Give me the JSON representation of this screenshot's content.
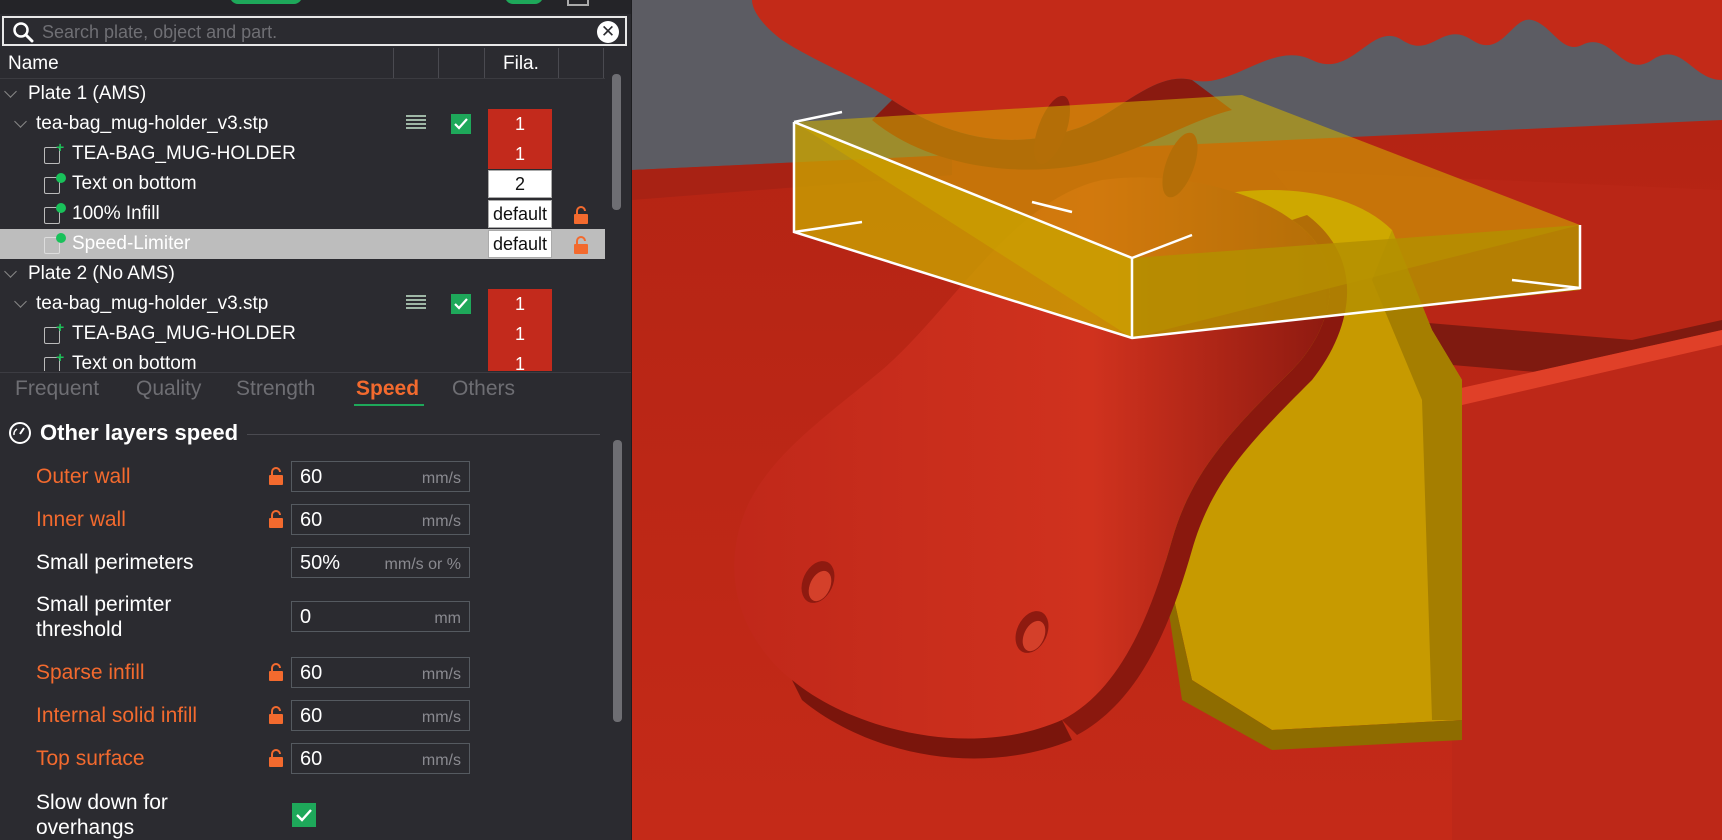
{
  "search": {
    "placeholder": "Search plate, object and part."
  },
  "objects_table": {
    "headers": {
      "name": "Name",
      "filament": "Fila."
    },
    "rows": [
      {
        "label": "Plate 1 (AMS)"
      },
      {
        "label": "tea-bag_mug-holder_v3.stp",
        "filament": "1"
      },
      {
        "label": "TEA-BAG_MUG-HOLDER",
        "filament": "1"
      },
      {
        "label": "Text on bottom",
        "filament": "2"
      },
      {
        "label": "100% Infill",
        "filament": "default"
      },
      {
        "label": "Speed-Limiter",
        "filament": "default",
        "selected": true
      },
      {
        "label": "Plate 2 (No AMS)"
      },
      {
        "label": "tea-bag_mug-holder_v3.stp",
        "filament": "1"
      },
      {
        "label": "TEA-BAG_MUG-HOLDER",
        "filament": "1"
      },
      {
        "label": "Text on bottom",
        "filament": "1"
      }
    ]
  },
  "settings_tabs": [
    "Frequent",
    "Quality",
    "Strength",
    "Speed",
    "Others"
  ],
  "active_tab": "Speed",
  "section": {
    "title": "Other layers speed"
  },
  "params": [
    {
      "label": "Outer wall",
      "value": "60",
      "unit": "mm/s"
    },
    {
      "label": "Inner wall",
      "value": "60",
      "unit": "mm/s"
    },
    {
      "label": "Small perimeters",
      "value": "50%",
      "unit": "mm/s or %"
    },
    {
      "label": "Small perimter threshold",
      "label_line1": "Small perimter",
      "label_line2": "threshold",
      "value": "0",
      "unit": "mm"
    },
    {
      "label": "Sparse infill",
      "value": "60",
      "unit": "mm/s"
    },
    {
      "label": "Internal solid infill",
      "value": "60",
      "unit": "mm/s"
    },
    {
      "label": "Top surface",
      "value": "60",
      "unit": "mm/s"
    },
    {
      "label": "Slow down for overhangs",
      "label_line1": "Slow down for",
      "label_line2": "overhangs",
      "checked": true
    }
  ],
  "colors": {
    "accent": "#1ea85a",
    "modified": "#f36a2e",
    "filament_red": "#c32a1c",
    "model_red": "#c72a18",
    "modifier_yellow": "#d4a800"
  },
  "icons": [
    "search-icon",
    "clear-search-icon",
    "gauge-icon",
    "lock-icon",
    "checkmark-icon",
    "layers-icon"
  ]
}
